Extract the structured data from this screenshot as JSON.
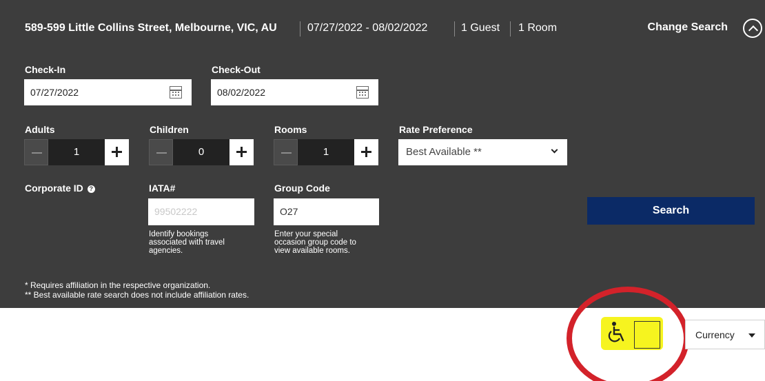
{
  "summary": {
    "address": "589-599 Little Collins Street, Melbourne, VIC, AU",
    "dates": "07/27/2022 - 08/02/2022",
    "guests": "1 Guest",
    "rooms": "1 Room",
    "change_search": "Change Search"
  },
  "checkin": {
    "label": "Check-In",
    "value": "07/27/2022"
  },
  "checkout": {
    "label": "Check-Out",
    "value": "08/02/2022"
  },
  "adults": {
    "label": "Adults",
    "value": "1"
  },
  "children": {
    "label": "Children",
    "value": "0"
  },
  "rooms": {
    "label": "Rooms",
    "value": "1"
  },
  "rate": {
    "label": "Rate Preference",
    "selected": "Best Available **"
  },
  "corporate": {
    "label": "Corporate ID"
  },
  "iata": {
    "label": "IATA#",
    "placeholder": "99502222",
    "help_lines": [
      "Identify bookings",
      "associated with travel",
      "agencies."
    ]
  },
  "group": {
    "label": "Group Code",
    "value": "O27",
    "help_lines": [
      "Enter your special",
      "occasion group code to",
      "view available rooms."
    ]
  },
  "search": {
    "label": "Search",
    "color": "#0b2a66"
  },
  "footnotes": [
    "* Requires affiliation in the respective organization.",
    "** Best available rate search does not include affiliation rates."
  ],
  "currency": {
    "label": "Currency"
  },
  "colors": {
    "panel": "#3d3d3d",
    "highlight": "#f6f41f",
    "annotation": "#d3222a"
  }
}
